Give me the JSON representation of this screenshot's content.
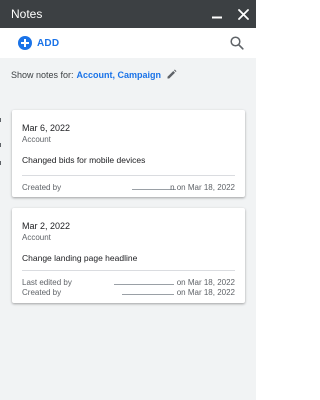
{
  "window": {
    "title": "Notes",
    "minimize_glyph": "▁",
    "close_glyph": "✕"
  },
  "toolbar": {
    "add_label": "ADD",
    "add_icon": "plus-circle-icon",
    "search_icon": "search-icon"
  },
  "filter": {
    "label": "Show notes for:",
    "value": "Account, Campaign",
    "edit_icon": "pencil-icon"
  },
  "notes": [
    {
      "date": "Mar 6, 2022",
      "level": "Account",
      "text": "Changed bids for mobile devices",
      "meta": [
        {
          "label": "Created by",
          "suffix": "n on Mar 18, 2022"
        }
      ]
    },
    {
      "date": "Mar 2, 2022",
      "level": "Account",
      "text": "Change landing page headline",
      "meta": [
        {
          "label": "Last edited by",
          "suffix": "on Mar 18, 2022"
        },
        {
          "label": "Created by",
          "suffix": "on Mar 18, 2022"
        }
      ]
    }
  ],
  "colors": {
    "title_bar": "#3c4043",
    "accent": "#1a73e8",
    "background": "#f1f3f4",
    "card": "#ffffff"
  }
}
